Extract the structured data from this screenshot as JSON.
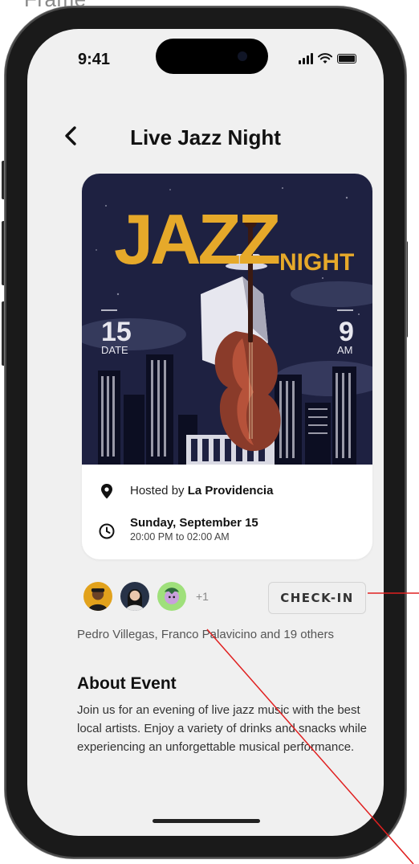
{
  "frame": {
    "label": "Frame"
  },
  "status_bar": {
    "time": "9:41"
  },
  "header": {
    "title": "Live Jazz Night",
    "back_icon": "chevron-left-icon"
  },
  "poster": {
    "headline": "JAZZ",
    "subheadline": "NIGHT",
    "left_number": "15",
    "left_caption": "DATE",
    "right_number": "9",
    "right_caption": "AM",
    "colors": {
      "background": "#1e2141",
      "accent": "#e6a92a",
      "bass": "#8a3b2a"
    }
  },
  "event": {
    "host_prefix": "Hosted by",
    "host_name": "La Providencia",
    "date": "Sunday, September 15",
    "time_range": "20:00 PM to 02:00 AM"
  },
  "attendance": {
    "more_count": "+1",
    "summary": "Pedro Villegas, Franco Palavicino and 19 others",
    "checkin_label": "CHECK-IN"
  },
  "about": {
    "title": "About Event",
    "body": "Join us for an evening of live jazz music with the best local artists. Enjoy a variety of drinks and snacks while experiencing an unforgettable musical performance."
  },
  "annotation": {
    "color": "#e02020"
  }
}
